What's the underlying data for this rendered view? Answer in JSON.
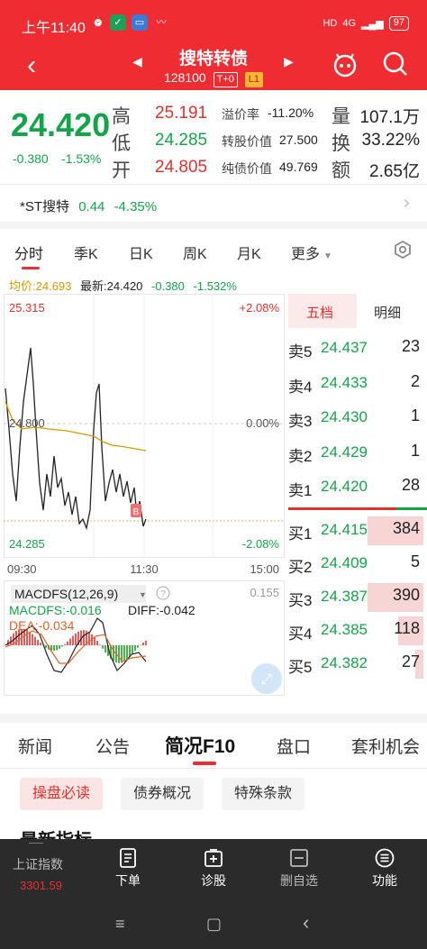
{
  "status_bar": {
    "time": "上午11:40",
    "network": "4G",
    "battery": "97"
  },
  "header": {
    "title": "搜特转债",
    "code": "128100",
    "tags": [
      "T+0",
      "L1"
    ]
  },
  "quote": {
    "price": "24.420",
    "change": "-0.380",
    "change_pct": "-1.53%",
    "high_label": "高",
    "high": "25.191",
    "low_label": "低",
    "low": "24.285",
    "open_label": "开",
    "open": "24.805",
    "premium_label": "溢价率",
    "premium": "-11.20%",
    "conv_label": "转股价值",
    "conv": "27.500",
    "bond_label": "纯债价值",
    "bond": "49.769",
    "vol_label": "量",
    "vol": "107.1万",
    "turnover_label": "换",
    "turnover": "33.22%",
    "amount_label": "额",
    "amount": "2.65亿"
  },
  "underlying": {
    "name": "*ST搜特",
    "price": "0.44",
    "change_pct": "-4.35%"
  },
  "period_tabs": [
    "分时",
    "季K",
    "日K",
    "周K",
    "月K",
    "更多"
  ],
  "avg_line": {
    "avg_label": "均价:",
    "avg": "24.693",
    "latest_label": "最新:",
    "latest": "24.420",
    "chg": "-0.380",
    "pct": "-1.532%"
  },
  "chart": {
    "top_price": "25.315",
    "top_pct": "+2.08%",
    "mid_price": "24.800",
    "mid_pct": "0.00%",
    "bot_price": "24.285",
    "bot_pct": "-2.08%",
    "times": [
      "09:30",
      "11:30",
      "15:00"
    ],
    "macd_title": "MACDFS(12,26,9)",
    "macd_line1": "MACDFS:-0.016",
    "diff": "DIFF:-0.042",
    "dea": "DEA:-0.034",
    "macd_max": "0.155",
    "marker": "B"
  },
  "order_book": {
    "tabs": [
      "五档",
      "明细"
    ],
    "asks": [
      {
        "label": "卖5",
        "price": "24.437",
        "vol": "23"
      },
      {
        "label": "卖4",
        "price": "24.433",
        "vol": "2"
      },
      {
        "label": "卖3",
        "price": "24.430",
        "vol": "1"
      },
      {
        "label": "卖2",
        "price": "24.429",
        "vol": "1"
      },
      {
        "label": "卖1",
        "price": "24.420",
        "vol": "28"
      }
    ],
    "bids": [
      {
        "label": "买1",
        "price": "24.415",
        "vol": "384",
        "bar": 1.0
      },
      {
        "label": "买2",
        "price": "24.409",
        "vol": "5",
        "bar": 0
      },
      {
        "label": "买3",
        "price": "24.387",
        "vol": "390",
        "bar": 1.0
      },
      {
        "label": "买4",
        "price": "24.385",
        "vol": "118",
        "bar": 0.45
      },
      {
        "label": "买5",
        "price": "24.382",
        "vol": "27",
        "bar": 0.15
      }
    ]
  },
  "news_tabs": [
    "新闻",
    "公告",
    "简况F10",
    "盘口",
    "套利机会"
  ],
  "chips": [
    "操盘必读",
    "债券概况",
    "特殊条款"
  ],
  "section_title": "最新指标",
  "bottom_nav": {
    "index_label": "上证指数",
    "index_value": "3301.59",
    "items": [
      "下单",
      "诊股",
      "删自选",
      "功能"
    ]
  }
}
